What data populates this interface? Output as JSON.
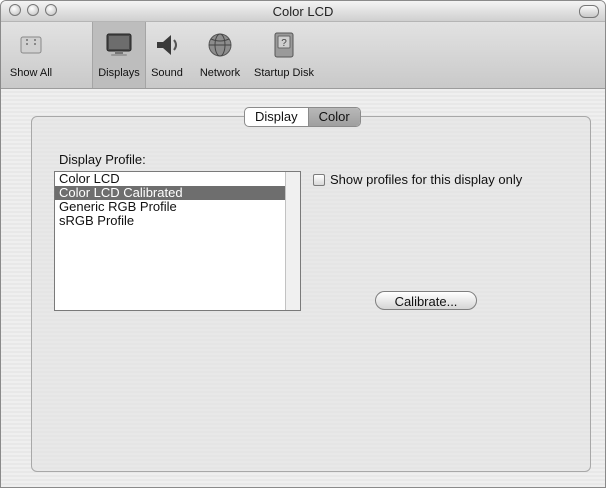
{
  "window": {
    "title": "Color LCD"
  },
  "toolbar": {
    "items": [
      {
        "label": "Show All",
        "icon": "show-all-icon"
      },
      {
        "label": "Displays",
        "icon": "display-monitor-icon"
      },
      {
        "label": "Sound",
        "icon": "speaker-icon"
      },
      {
        "label": "Network",
        "icon": "globe-icon"
      },
      {
        "label": "Startup Disk",
        "icon": "hard-disk-icon"
      }
    ]
  },
  "tabs": [
    {
      "label": "Display"
    },
    {
      "label": "Color"
    }
  ],
  "profile": {
    "label": "Display Profile:",
    "items": [
      "Color LCD",
      "Color LCD Calibrated",
      "Generic RGB Profile",
      "sRGB Profile"
    ],
    "selected": "Color LCD Calibrated"
  },
  "checkbox": {
    "label": "Show profiles for this display only"
  },
  "calibrate_button": {
    "label": "Calibrate..."
  }
}
